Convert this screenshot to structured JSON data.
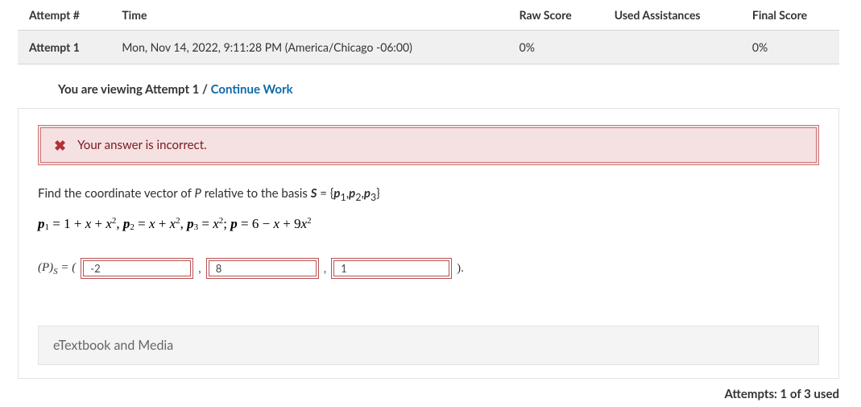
{
  "table": {
    "headers": {
      "attempt": "Attempt #",
      "time": "Time",
      "raw": "Raw Score",
      "used": "Used Assistances",
      "final": "Final Score"
    },
    "row": {
      "attempt": "Attempt 1",
      "time": "Mon, Nov 14, 2022, 9:11:28 PM (America/Chicago -06:00)",
      "raw": "0%",
      "used": "",
      "final": "0%"
    }
  },
  "viewing": {
    "prefix": "You are viewing Attempt 1",
    "sep": " / ",
    "link": "Continue Work"
  },
  "alert": {
    "text": "Your answer is incorrect."
  },
  "prompt": {
    "p1a": "Find the coordinate vector of ",
    "p1b": "P",
    "p1c": " relative to the basis ",
    "p1d": "S",
    "p1e": " = {",
    "p1f": "p",
    "p1g": "1",
    "p1h": ",",
    "p1i": "p",
    "p1j": "2",
    "p1k": ",",
    "p1l": "p",
    "p1m": "3",
    "p1n": "}"
  },
  "math": {
    "p1l": "p",
    "p1s": "1",
    "eq": " = 1 + ",
    "x1": "x",
    "plus1": " + ",
    "x2": "x",
    "sq1": "2",
    "c1": ", ",
    "p2l": "p",
    "p2s": "2",
    "eq2": " = ",
    "x3": "x",
    "plus2": " + ",
    "x4": "x",
    "sq2": "2",
    "c2": ", ",
    "p3l": "p",
    "p3s": "3",
    "eq3": " = ",
    "x5": "x",
    "sq3": "2",
    "sc": "; ",
    "pl": "p",
    "eq4": " = 6 − ",
    "x6": "x",
    "plus3": " + 9",
    "x7": "x",
    "sq4": "2"
  },
  "answer": {
    "lhs_open": "(",
    "lhs_P": "P",
    "lhs_close": ")",
    "lhs_sub": "S",
    "lhs_eq": " = ( ",
    "v1": "-2",
    "v2": "8",
    "v3": "1",
    "close": " )."
  },
  "etextbook": "eTextbook and Media",
  "attempts_used": "Attempts: 1 of 3 used"
}
